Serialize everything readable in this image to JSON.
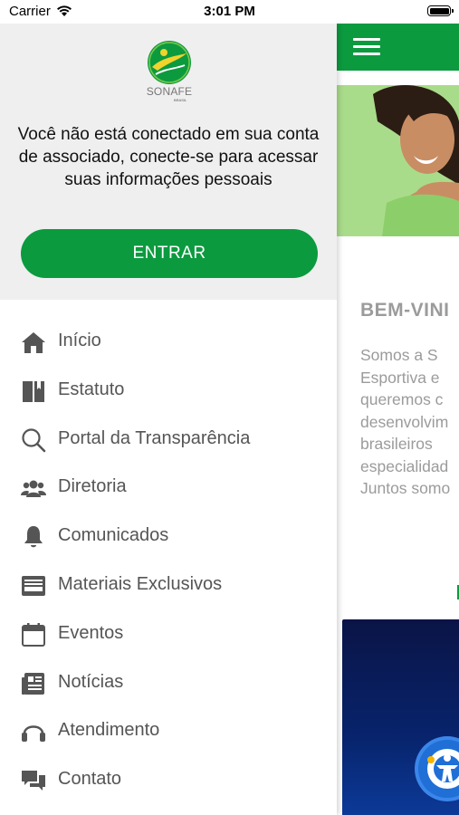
{
  "status_bar": {
    "carrier": "Carrier",
    "time": "3:01 PM"
  },
  "drawer": {
    "logo_text": "SONAFE",
    "logo_subtext": "BRASIL",
    "login_message_lines": [
      "Você não está conectado em sua conta",
      "de associado, conecte-se para acessar",
      "suas informações pessoais"
    ],
    "enter_button": "ENTRAR",
    "menu": [
      {
        "label": "Início",
        "icon": "home-icon"
      },
      {
        "label": "Estatuto",
        "icon": "book-icon"
      },
      {
        "label": "Portal da Transparência",
        "icon": "search-icon"
      },
      {
        "label": "Diretoria",
        "icon": "people-icon"
      },
      {
        "label": "Comunicados",
        "icon": "bell-icon"
      },
      {
        "label": "Materiais Exclusivos",
        "icon": "inbox-icon"
      },
      {
        "label": "Eventos",
        "icon": "calendar-icon"
      },
      {
        "label": "Notícias",
        "icon": "newspaper-icon"
      },
      {
        "label": "Atendimento",
        "icon": "headset-icon"
      },
      {
        "label": "Contato",
        "icon": "chat-icon"
      }
    ]
  },
  "main": {
    "welcome_title": "BEM-VINI",
    "about_lines": [
      "Somos a S",
      "Esportiva e",
      "queremos c",
      "desenvolvim",
      "brasileiros",
      "especialidad",
      "Juntos somo"
    ]
  },
  "colors": {
    "brand_green": "#0c9a3f",
    "header_gray": "#efefef",
    "muted_text": "#9b9b9b"
  }
}
